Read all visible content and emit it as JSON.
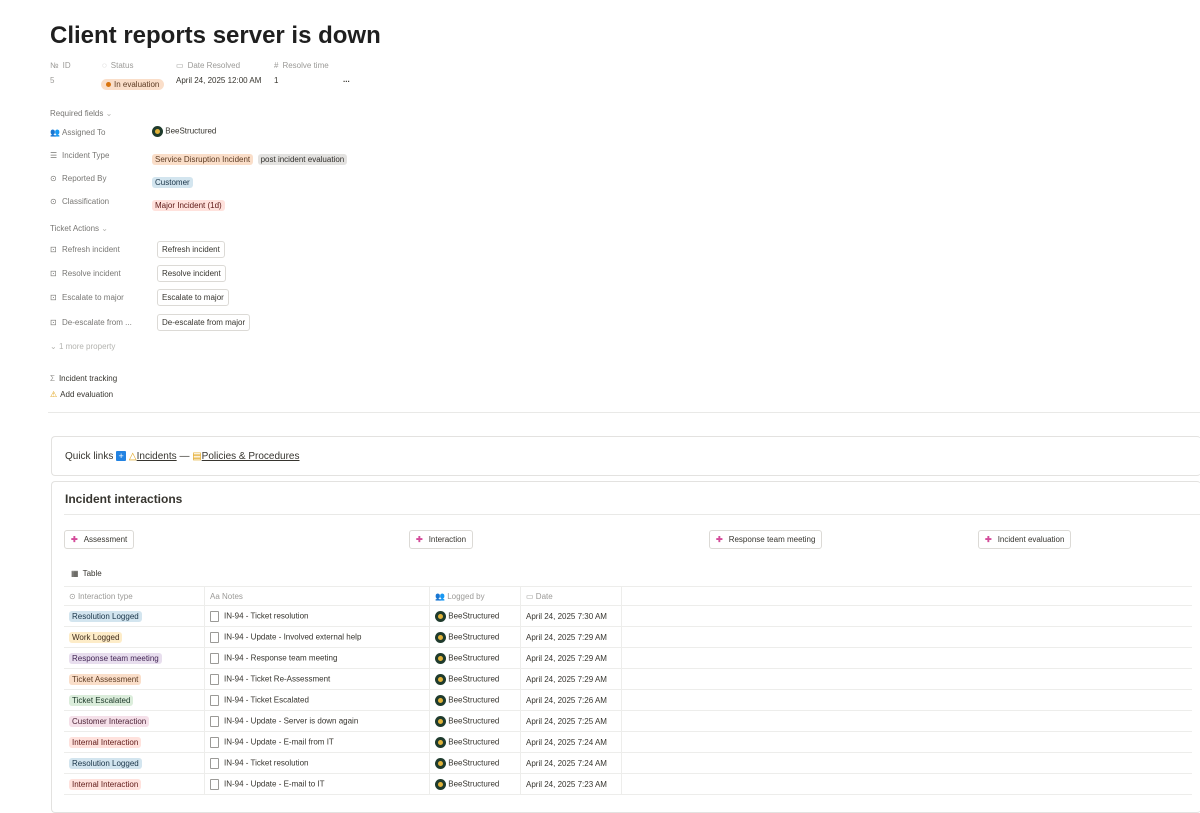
{
  "page": {
    "title": "Client reports server is down"
  },
  "properties_header": [
    {
      "icon": "№",
      "label": "ID",
      "value": "5"
    },
    {
      "icon": "◌",
      "label": "Status",
      "value": "In evaluation"
    },
    {
      "icon": "▭",
      "label": "Date Resolved",
      "value": "April 24, 2025 12:00 AM"
    },
    {
      "icon": "#",
      "label": "Resolve time",
      "value": "1"
    }
  ],
  "more_label": "...",
  "required_fields": {
    "label": "Required fields",
    "assigned_to": {
      "label": "Assigned To",
      "value": "BeeStructured"
    },
    "incident_type": {
      "label": "Incident Type",
      "values": [
        "Service Disruption Incident",
        "post incident evaluation"
      ]
    },
    "reported_by": {
      "label": "Reported By",
      "value": "Customer"
    },
    "classification": {
      "label": "Classification",
      "value": "Major Incident (1d)"
    }
  },
  "ticket_actions": {
    "label": "Ticket Actions",
    "items": [
      {
        "label": "Refresh incident",
        "button": "Refresh incident"
      },
      {
        "label": "Resolve incident",
        "button": "Resolve incident"
      },
      {
        "label": "Escalate to major",
        "button": "Escalate to major"
      },
      {
        "label": "De-escalate from ...",
        "button": "De-escalate from major"
      }
    ],
    "more": "1 more property"
  },
  "incident_tracking": {
    "label": "Incident tracking",
    "add_eval": "Add evaluation"
  },
  "quick_links": {
    "label": "Quick links",
    "incidents": "Incidents",
    "sep": "—",
    "policies": "Policies & Procedures"
  },
  "interactions": {
    "title": "Incident interactions",
    "buttons": [
      "Assessment",
      "Interaction",
      "Response team meeting",
      "Incident evaluation"
    ],
    "view_label": "Table",
    "columns": [
      "Interaction type",
      "Notes",
      "Logged by",
      "Date"
    ],
    "rows": [
      {
        "type": "Resolution Logged",
        "color": "blue",
        "notes": "IN-94 - Ticket resolution",
        "by": "BeeStructured",
        "date": "April 24, 2025 7:30 AM"
      },
      {
        "type": "Work Logged",
        "color": "yellow",
        "notes": "IN-94 - Update - Involved external help",
        "by": "BeeStructured",
        "date": "April 24, 2025 7:29 AM"
      },
      {
        "type": "Response team meeting",
        "color": "purple",
        "notes": "IN-94 - Response team meeting",
        "by": "BeeStructured",
        "date": "April 24, 2025 7:29 AM"
      },
      {
        "type": "Ticket Assessment",
        "color": "orange",
        "notes": "IN-94 - Ticket Re-Assessment",
        "by": "BeeStructured",
        "date": "April 24, 2025 7:29 AM"
      },
      {
        "type": "Ticket Escalated",
        "color": "green",
        "notes": "IN-94 - Ticket Escalated",
        "by": "BeeStructured",
        "date": "April 24, 2025 7:26 AM"
      },
      {
        "type": "Customer Interaction",
        "color": "pink",
        "notes": "IN-94 - Update - Server is down again",
        "by": "BeeStructured",
        "date": "April 24, 2025 7:25 AM"
      },
      {
        "type": "Internal Interaction",
        "color": "red",
        "notes": "IN-94 - Update - E-mail from IT",
        "by": "BeeStructured",
        "date": "April 24, 2025 7:24 AM"
      },
      {
        "type": "Resolution Logged",
        "color": "blue",
        "notes": "IN-94 - Ticket resolution",
        "by": "BeeStructured",
        "date": "April 24, 2025 7:24 AM"
      },
      {
        "type": "Internal Interaction",
        "color": "red",
        "notes": "IN-94 - Update - E-mail to IT",
        "by": "BeeStructured",
        "date": "April 24, 2025 7:23 AM"
      }
    ]
  }
}
